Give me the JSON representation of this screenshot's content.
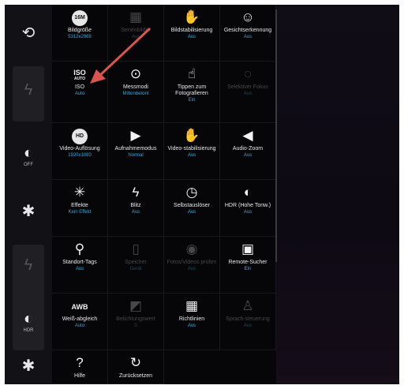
{
  "side_panel": {
    "items": [
      {
        "icon": "switch-camera-icon",
        "glyph": "⟲",
        "caption": ""
      },
      {
        "icon": "flash-placeholder-icon",
        "glyph": "⚡",
        "caption": ""
      },
      {
        "icon": "hdr-off-icon",
        "glyph": "◐",
        "caption": "OFF"
      },
      {
        "icon": "gear-icon",
        "glyph": "✱",
        "caption": ""
      },
      {
        "icon": "flash-placeholder-icon",
        "glyph": "⚡",
        "caption": ""
      },
      {
        "icon": "hdr-icon",
        "glyph": "◐",
        "caption": "HDR"
      },
      {
        "icon": "gear-icon",
        "glyph": "✱",
        "caption": ""
      }
    ]
  },
  "settings_grid": {
    "cells": [
      {
        "label": "Bildgröße",
        "value": "5312x2988",
        "icon_text": "16M",
        "enabled": true
      },
      {
        "label": "Serienbilder",
        "value": "Aus",
        "icon_text": "",
        "enabled": false
      },
      {
        "label": "Bildstabilisierung",
        "value": "Aus",
        "icon_text": "",
        "enabled": true
      },
      {
        "label": "Gesichtserkennung",
        "value": "Aus",
        "icon_text": "",
        "enabled": true
      },
      {
        "label": "ISO",
        "value": "Auto",
        "icon_text": "ISO",
        "icon_sub": "AUTO",
        "enabled": true
      },
      {
        "label": "Messmodi",
        "value": "Mittenbetont",
        "icon_text": "",
        "enabled": true
      },
      {
        "label": "Tippen zum Fotografieren",
        "value": "Ein",
        "icon_text": "",
        "enabled": true
      },
      {
        "label": "Selektiver Fokus",
        "value": "Aus",
        "icon_text": "",
        "enabled": false
      },
      {
        "label": "Video-Auflösung",
        "value": "1920x1080",
        "icon_text": "",
        "enabled": true
      },
      {
        "label": "Aufnahmemodus",
        "value": "Normal",
        "icon_text": "",
        "enabled": true
      },
      {
        "label": "Video-stabilisierung",
        "value": "Aus",
        "icon_text": "",
        "enabled": true
      },
      {
        "label": "Audio-Zoom",
        "value": "Aus",
        "icon_text": "",
        "enabled": true
      },
      {
        "label": "Effekte",
        "value": "Kein Effekt",
        "icon_text": "",
        "enabled": true
      },
      {
        "label": "Blitz",
        "value": "Aus",
        "icon_text": "",
        "enabled": true
      },
      {
        "label": "Selbstauslöser",
        "value": "Aus",
        "icon_text": "",
        "enabled": true
      },
      {
        "label": "HDR (Hohe Tonw.)",
        "value": "Aus",
        "icon_text": "",
        "enabled": true
      },
      {
        "label": "Standort-Tags",
        "value": "Aus",
        "icon_text": "",
        "enabled": true
      },
      {
        "label": "Speicher",
        "value": "Gerät",
        "icon_text": "",
        "enabled": false
      },
      {
        "label": "Fotos/Videos prüfen",
        "value": "Aus",
        "icon_text": "",
        "enabled": false
      },
      {
        "label": "Remote-Sucher",
        "value": "Ein",
        "icon_text": "",
        "enabled": true
      },
      {
        "label": "Weiß-abgleich",
        "value": "Auto",
        "icon_text": "AWB",
        "enabled": true
      },
      {
        "label": "Belichtungswert",
        "value": "0",
        "icon_text": "",
        "enabled": false
      },
      {
        "label": "Richtlinien",
        "value": "Aus",
        "icon_text": "",
        "enabled": true
      },
      {
        "label": "Sprach-steuerung",
        "value": "Aus",
        "icon_text": "",
        "enabled": false
      },
      {
        "label": "Hilfe",
        "value": "",
        "icon_text": "",
        "enabled": true
      },
      {
        "label": "Zurücksetzen",
        "value": "",
        "icon_text": "",
        "enabled": true
      }
    ]
  },
  "annotation": {
    "arrow_color": "#d9534f"
  },
  "colors": {
    "value_blue": "#2aa7dc",
    "background": "#0c0b10"
  }
}
